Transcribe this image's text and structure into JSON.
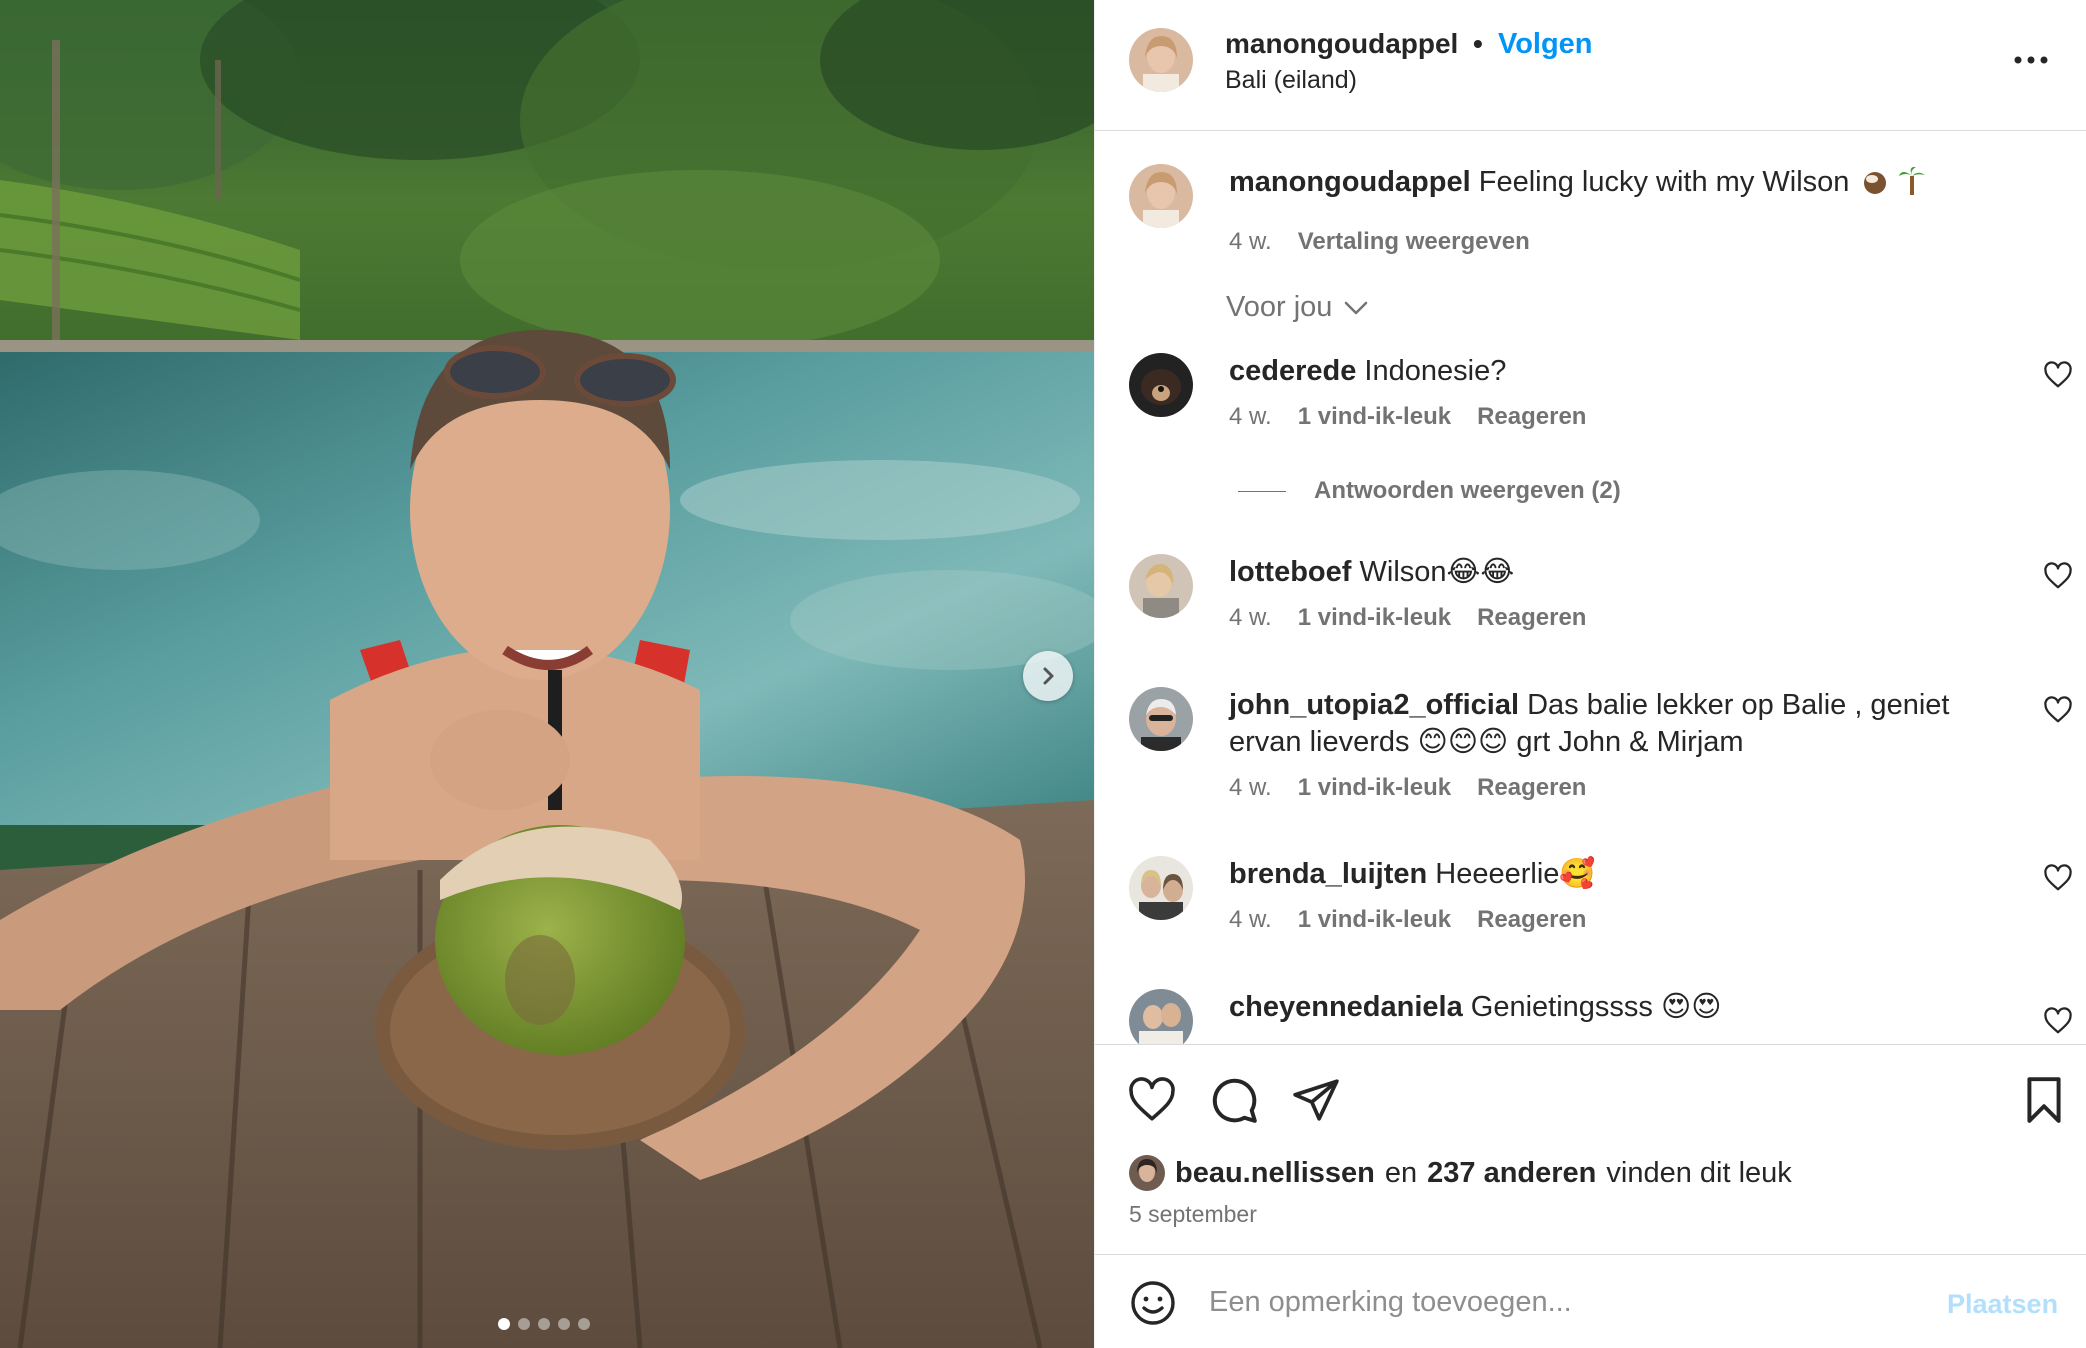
{
  "post": {
    "author": "manongoudappel",
    "separator": "•",
    "follow_label": "Volgen",
    "location": "Bali (eiland)",
    "more_icon": "ellipsis-icon",
    "carousel": {
      "slide_count": 5,
      "active_slide": 1,
      "next_icon": "chevron-right-icon"
    }
  },
  "caption": {
    "username": "manongoudappel",
    "text": "Feeling lucky with my Wilson",
    "emojis": [
      "coconut",
      "palm-tree"
    ],
    "age": "4 w.",
    "translate_label": "Vertaling weergeven"
  },
  "sort": {
    "label": "Voor jou",
    "icon": "chevron-down-icon"
  },
  "comments": [
    {
      "username": "cederede",
      "text": "Indonesie?",
      "age": "4 w.",
      "likes": "1 vind-ik-leuk",
      "reply_label": "Reageren",
      "replies_label": "Antwoorden weergeven (2)"
    },
    {
      "username": "lotteboef",
      "text": "Wilson😂😂",
      "age": "4 w.",
      "likes": "1 vind-ik-leuk",
      "reply_label": "Reageren"
    },
    {
      "username": "john_utopia2_official",
      "text": "Das balie lekker op Balie , geniet ervan lieverds 😊😊😊 grt John & Mirjam",
      "age": "4 w.",
      "likes": "1 vind-ik-leuk",
      "reply_label": "Reageren"
    },
    {
      "username": "brenda_luijten",
      "text": "Heeeerlie🥰",
      "age": "4 w.",
      "likes": "1 vind-ik-leuk",
      "reply_label": "Reageren"
    },
    {
      "username": "cheyennedaniela",
      "text": "Genietingssss 😍😍"
    }
  ],
  "actions": {
    "like_icon": "heart-icon",
    "comment_icon": "comment-icon",
    "share_icon": "send-icon",
    "save_icon": "bookmark-icon"
  },
  "likes": {
    "user": "beau.nellissen",
    "connector": "en",
    "others": "237 anderen",
    "suffix": "vinden dit leuk"
  },
  "date": "5 september",
  "composer": {
    "placeholder": "Een opmerking toevoegen...",
    "post_label": "Plaatsen",
    "emoji_icon": "smiley-icon"
  },
  "colors": {
    "accent": "#0095f6",
    "post_disabled": "#b2dffc",
    "muted": "#737373",
    "text": "#262626"
  }
}
